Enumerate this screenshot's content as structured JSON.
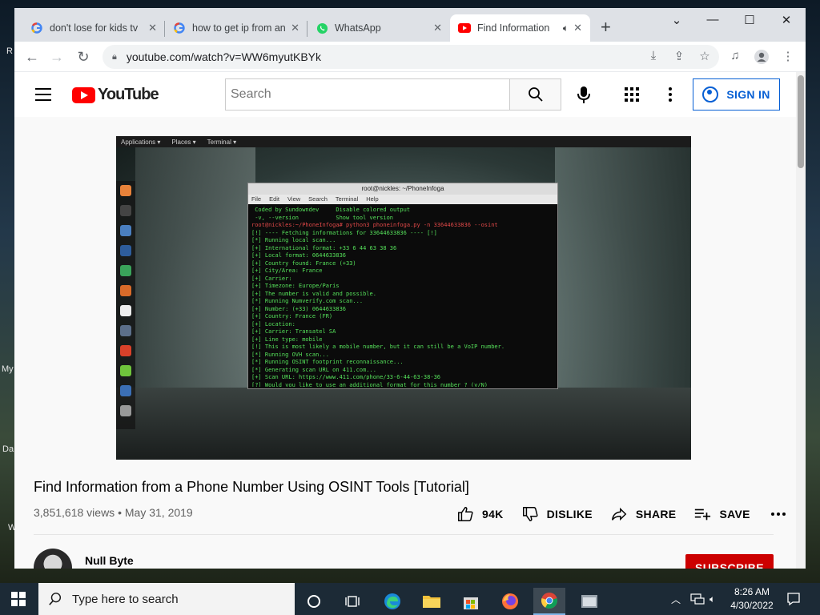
{
  "desktop": {
    "labels": [
      "R",
      "My",
      "Da",
      "W"
    ]
  },
  "browser": {
    "tabs": [
      {
        "title": "don't lose for kids tv",
        "icon": "google-icon",
        "active": false
      },
      {
        "title": "how to get ip from an",
        "icon": "google-icon",
        "active": false
      },
      {
        "title": "WhatsApp",
        "icon": "whatsapp-icon",
        "active": false
      },
      {
        "title": "Find Information",
        "icon": "youtube-icon",
        "active": true,
        "audio": true
      }
    ],
    "url": "youtube.com/watch?v=WW6myutKBYk"
  },
  "youtube": {
    "search_placeholder": "Search",
    "sign_in_label": "SIGN IN",
    "video": {
      "title": "Find Information from a Phone Number Using OSINT Tools [Tutorial]",
      "views": "3,851,618 views",
      "date": "May 31, 2019",
      "likes": "94K",
      "dislike_label": "DISLIKE",
      "share_label": "SHARE",
      "save_label": "SAVE"
    },
    "channel": {
      "name": "Null Byte",
      "subscribe_label": "SUBSCRIBE"
    },
    "player": {
      "desktop_menu": [
        "Applications ▾",
        "Places ▾",
        "Terminal ▾"
      ],
      "terminal_title": "root@nickles: ~/PhoneInfoga",
      "terminal_menu": [
        "File",
        "Edit",
        "View",
        "Search",
        "Terminal",
        "Help"
      ],
      "terminal_lines": [
        " Coded by Sundowndev     Disable colored output",
        " -v, --version           Show tool version",
        "root@nickles:~/PhoneInfoga# python3 phoneinfoga.py -n 33644633836 --osint",
        "[!] ---- Fetching informations for 33644633836 ---- [!]",
        "[*] Running local scan...",
        "[+] International format: +33 6 44 63 38 36",
        "[+] Local format: 0644633836",
        "[+] Country found: France (+33)",
        "[+] City/Area: France",
        "[+] Carrier:",
        "[+] Timezone: Europe/Paris",
        "[+] The number is valid and possible.",
        "[*] Running Numverify.com scan...",
        "[+] Number: (+33) 0644633836",
        "[+] Country: France (FR)",
        "[+] Location:",
        "[+] Carrier: Transatel SA",
        "[+] Line type: mobile",
        "[!] This is most likely a mobile number, but it can still be a VoIP number.",
        "[*] Running OVH scan...",
        "[*] Running OSINT footprint reconnaissance...",
        "[*] Generating scan URL on 411.com...",
        "[+] Scan URL: https://www.411.com/phone/33-6-44-63-38-36",
        "[?] Would you like to use an additional format for this number ? (y/N)"
      ]
    }
  },
  "taskbar": {
    "search_placeholder": "Type here to search",
    "time": "8:26 AM",
    "date": "4/30/2022"
  },
  "colors": {
    "youtube_red": "#ff0000",
    "link_blue": "#065fd4",
    "subscribe_red": "#cc0000"
  }
}
